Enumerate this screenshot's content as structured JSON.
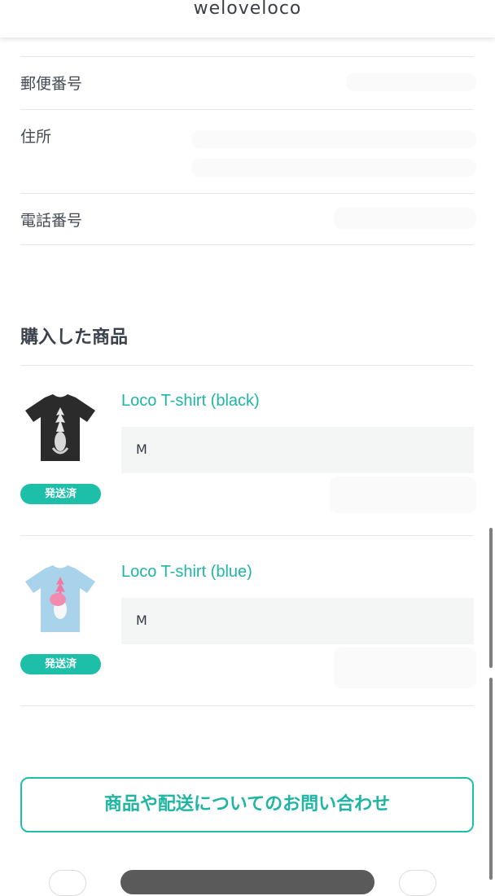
{
  "header": {
    "brand": "weloveloco"
  },
  "address_form": {
    "postal_label": "郵便番号",
    "address_label": "住所",
    "phone_label": "電話番号"
  },
  "purchased": {
    "title": "購入した商品",
    "items": [
      {
        "name": "Loco T-shirt (black)",
        "option": "M",
        "status": "発送済",
        "shirt_color": "#2b2b2b"
      },
      {
        "name": "Loco T-shirt (blue)",
        "option": "M",
        "status": "発送済",
        "shirt_color": "#a9d3ea"
      }
    ]
  },
  "contact_button": "商品や配送についてのお問い合わせ",
  "colors": {
    "accent": "#1dbfa9",
    "link": "#1fb5a3"
  }
}
